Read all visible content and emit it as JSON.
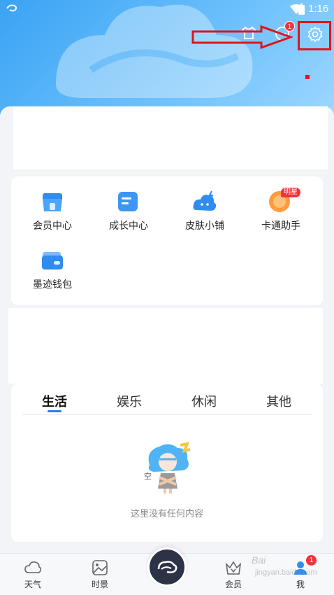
{
  "status_bar": {
    "time": "1:16"
  },
  "header": {
    "message_badge": "1"
  },
  "services": {
    "items": [
      {
        "label": "会员中心",
        "icon": "member-store-icon"
      },
      {
        "label": "成长中心",
        "icon": "growth-doc-icon"
      },
      {
        "label": "皮肤小铺",
        "icon": "skin-cloud-icon"
      },
      {
        "label": "卡通助手",
        "icon": "cartoon-assistant-icon",
        "badge": "明星"
      },
      {
        "label": "墨迹钱包",
        "icon": "wallet-icon"
      }
    ]
  },
  "tabs": [
    {
      "label": "生活",
      "active": true
    },
    {
      "label": "娱乐"
    },
    {
      "label": "休闲"
    },
    {
      "label": "其他"
    }
  ],
  "empty_state": {
    "text": "这里没有任何内容",
    "illustration_text": "空"
  },
  "bottom_nav": {
    "items": [
      {
        "label": "天气",
        "icon": "weather-cloud-icon"
      },
      {
        "label": "时景",
        "icon": "photo-icon"
      },
      {
        "label": "会员",
        "icon": "vip-crown-icon"
      },
      {
        "label": "我",
        "icon": "profile-icon",
        "badge": "1"
      }
    ]
  },
  "watermark": {
    "line1": "Bai",
    "line2": "jingyan.baidu.com"
  },
  "colors": {
    "accent": "#2b7de9",
    "badge": "#f5313c",
    "highlight": "#e1141e"
  }
}
